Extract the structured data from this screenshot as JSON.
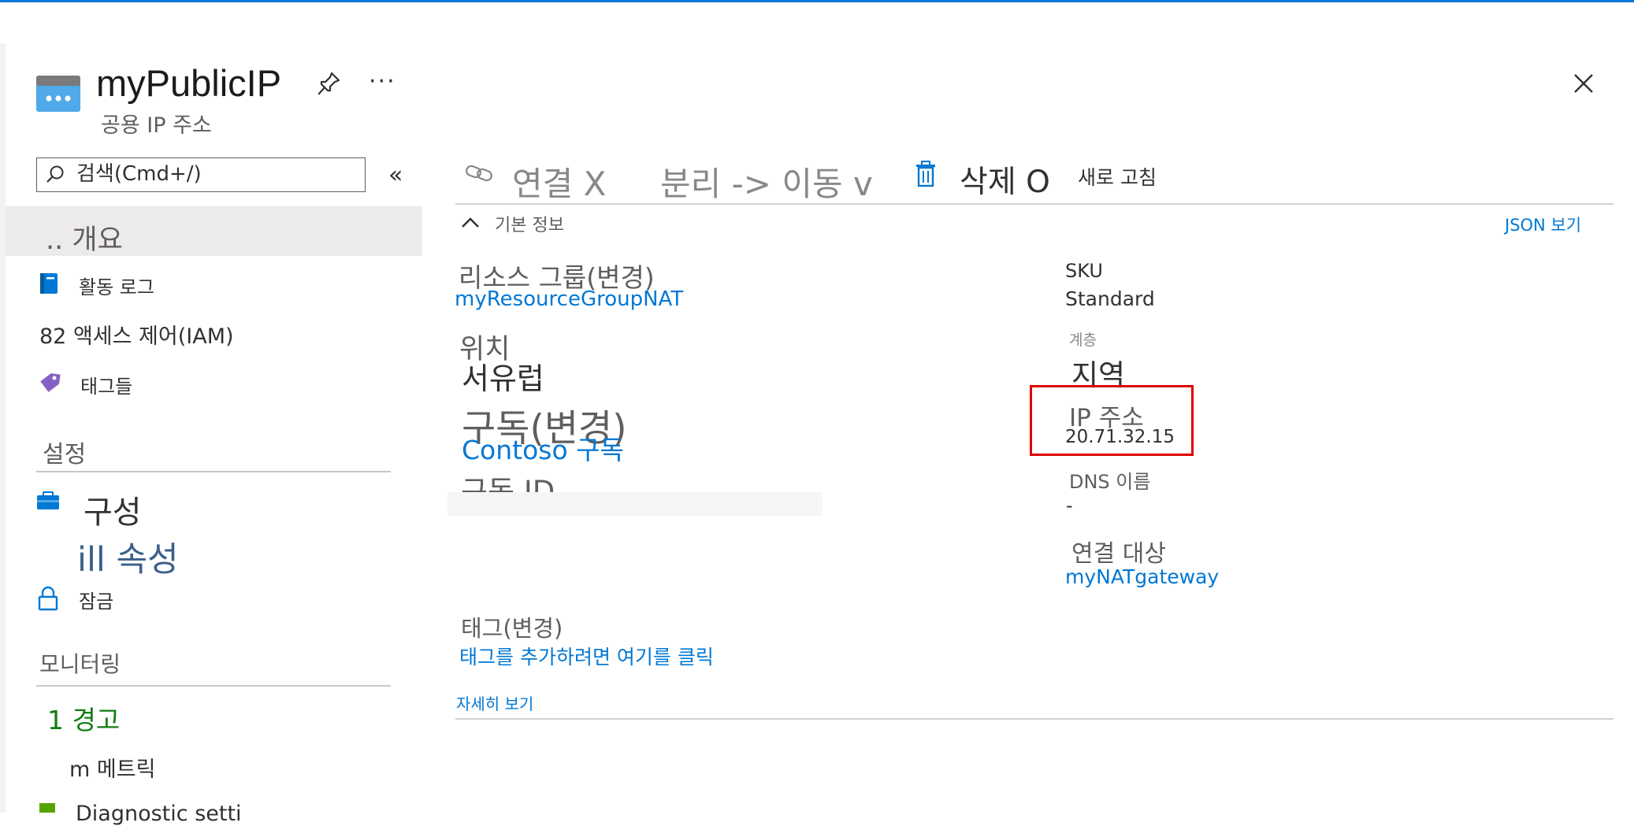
{
  "resource": {
    "title": "myPublicIP",
    "subtitle": "공용 IP 주소"
  },
  "search": {
    "placeholder": "검색(Cmd+/)"
  },
  "sidebar": {
    "collapse_glyph": "«",
    "overview": ".. 개요",
    "activity_log": "활동 로그",
    "iam": "82 액세스 제어(IAM)",
    "tags": "태그들",
    "settings_header": "설정",
    "configuration": "구성",
    "properties": "ill 속성",
    "locks": "잠금",
    "monitoring_header": "모니터링",
    "alerts": "1 경고",
    "metrics": "m 메트릭",
    "diagnostic": "Diagnostic setti"
  },
  "toolbar": {
    "connect": "연결 X",
    "dissociate": "분리 -> 이동 v",
    "delete": "삭제 O",
    "refresh": "새로 고침"
  },
  "essentials": {
    "header": "기본 정보",
    "json_view": "JSON 보기",
    "resource_group_label": "리소스 그룹(변경)",
    "resource_group_value": "myResourceGroupNAT",
    "location_label": "위치",
    "location_value": "서유럽",
    "subscription_label": "구독(변경)",
    "subscription_value": "Contoso 구독",
    "subscription_id_label": "구독 ID",
    "sku_label": "SKU",
    "sku_value": "Standard",
    "tier_label": "계층",
    "tier_value": "지역",
    "ip_label": "IP 주소",
    "ip_value": "20.71.32.15",
    "dns_label": "DNS 이름",
    "dns_value": "-",
    "associated_label": "연결 대상",
    "associated_value": "myNATgateway",
    "tags_label": "태그(변경)",
    "tags_value": "태그를 추가하려면 여기를 클릭",
    "see_more": "자세히 보기"
  },
  "colors": {
    "accent": "#0078d4",
    "highlight_box": "#dd0000",
    "selected_bg": "#edebe9",
    "alerts_green": "#107c10"
  }
}
